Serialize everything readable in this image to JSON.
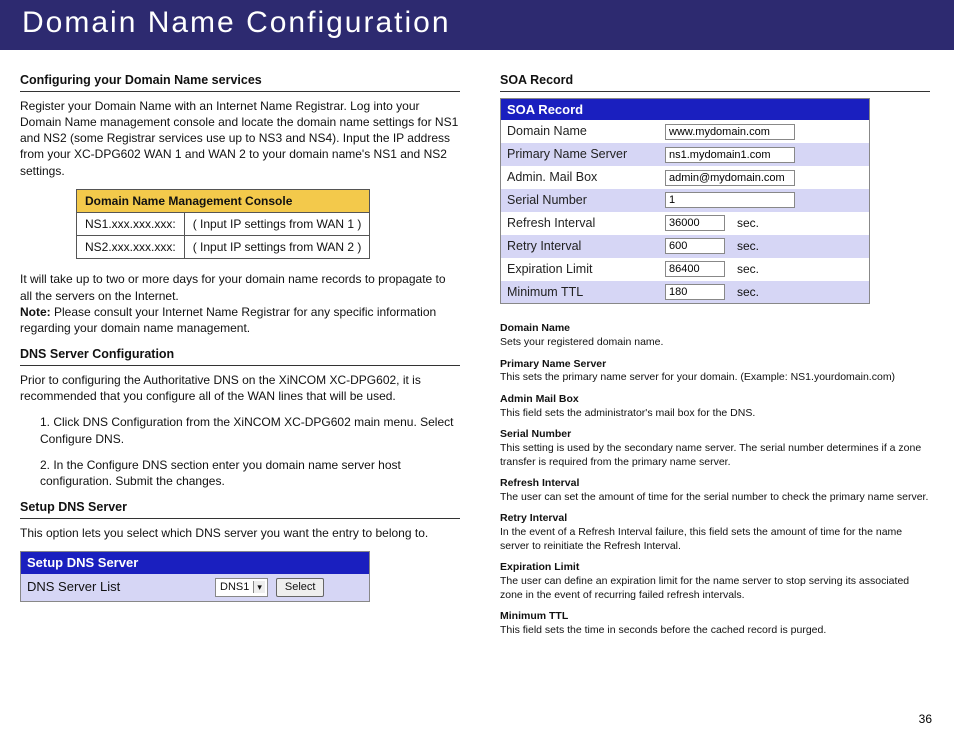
{
  "page": {
    "title": "Domain Name Configuration",
    "number": "36"
  },
  "left": {
    "s1_title": "Configuring your Domain Name services",
    "s1_body": "Register your Domain Name with an Internet Name Registrar. Log into your Domain Name management console and locate the domain name settings for NS1 and NS2 (some Registrar services use up to NS3 and NS4).  Input the IP address from your XC-DPG602 WAN 1 and WAN 2 to your domain name's NS1 and NS2 settings.",
    "console": {
      "header": "Domain Name Management Console",
      "rows": [
        {
          "c1": "NS1.xxx.xxx.xxx:",
          "c2": "( Input IP settings from WAN 1 )"
        },
        {
          "c1": "NS2.xxx.xxx.xxx:",
          "c2": "( Input IP settings from WAN 2 )"
        }
      ]
    },
    "s1_after": "It will take up to two or more days for your domain name records to propagate to all the servers on the Internet.",
    "s1_note_label": "Note:",
    "s1_note": " Please consult your Internet Name Registrar for any specific information regarding your domain name management.",
    "s2_title": "DNS Server Configuration",
    "s2_body": "Prior to configuring the Authoritative DNS on the XiNCOM XC-DPG602, it is recommended that you configure all of the WAN lines that will be used.",
    "s2_step1": "1. Click DNS Configuration from the XiNCOM XC-DPG602 main menu. Select Configure DNS.",
    "s2_step2": "2. In the Configure DNS section enter you domain name server host configuration. Submit the changes.",
    "s3_title": "Setup DNS Server",
    "s3_body": "This option lets you select which DNS server you want the entry to belong to.",
    "setup_panel": {
      "header": "Setup DNS Server",
      "label": "DNS Server List",
      "selected": "DNS1",
      "button": "Select"
    }
  },
  "right": {
    "title": "SOA Record",
    "panel": {
      "header": "SOA Record",
      "fields": [
        {
          "label": "Domain Name",
          "value": "www.mydomain.com",
          "unit": "",
          "alt": false,
          "narrow": false
        },
        {
          "label": "Primary Name Server",
          "value": "ns1.mydomain1.com",
          "unit": "",
          "alt": true,
          "narrow": false
        },
        {
          "label": "Admin. Mail Box",
          "value": "admin@mydomain.com",
          "unit": "",
          "alt": false,
          "narrow": false
        },
        {
          "label": "Serial Number",
          "value": "1",
          "unit": "",
          "alt": true,
          "narrow": false
        },
        {
          "label": "Refresh Interval",
          "value": "36000",
          "unit": "sec.",
          "alt": false,
          "narrow": true
        },
        {
          "label": "Retry Interval",
          "value": "600",
          "unit": "sec.",
          "alt": true,
          "narrow": true
        },
        {
          "label": "Expiration Limit",
          "value": "86400",
          "unit": "sec.",
          "alt": false,
          "narrow": true
        },
        {
          "label": "Minimum TTL",
          "value": "180",
          "unit": "sec.",
          "alt": true,
          "narrow": true
        }
      ]
    },
    "descriptions": [
      {
        "t": "Domain Name",
        "b": "Sets your registered domain name."
      },
      {
        "t": "Primary Name Server",
        "b": "This sets the primary name server for your domain.  (Example: NS1.yourdomain.com)"
      },
      {
        "t": "Admin Mail Box",
        "b": "This field sets the administrator's mail box for the DNS."
      },
      {
        "t": "Serial Number",
        "b": "This setting is used by the secondary name server.  The serial number determines if a zone transfer is required from the primary name server."
      },
      {
        "t": "Refresh Interval",
        "b": "The user can set the amount of time for the serial number to check the primary name server."
      },
      {
        "t": "Retry Interval",
        "b": "In the event of a Refresh Interval failure, this field sets the amount of time for the name server to reinitiate the Refresh Interval."
      },
      {
        "t": "Expiration Limit",
        "b": "The user can define an expiration limit for the name server to stop serving its associated zone in the event of recurring failed refresh intervals."
      },
      {
        "t": "Minimum TTL",
        "b": "This field sets the time in seconds before the cached record is purged."
      }
    ]
  }
}
